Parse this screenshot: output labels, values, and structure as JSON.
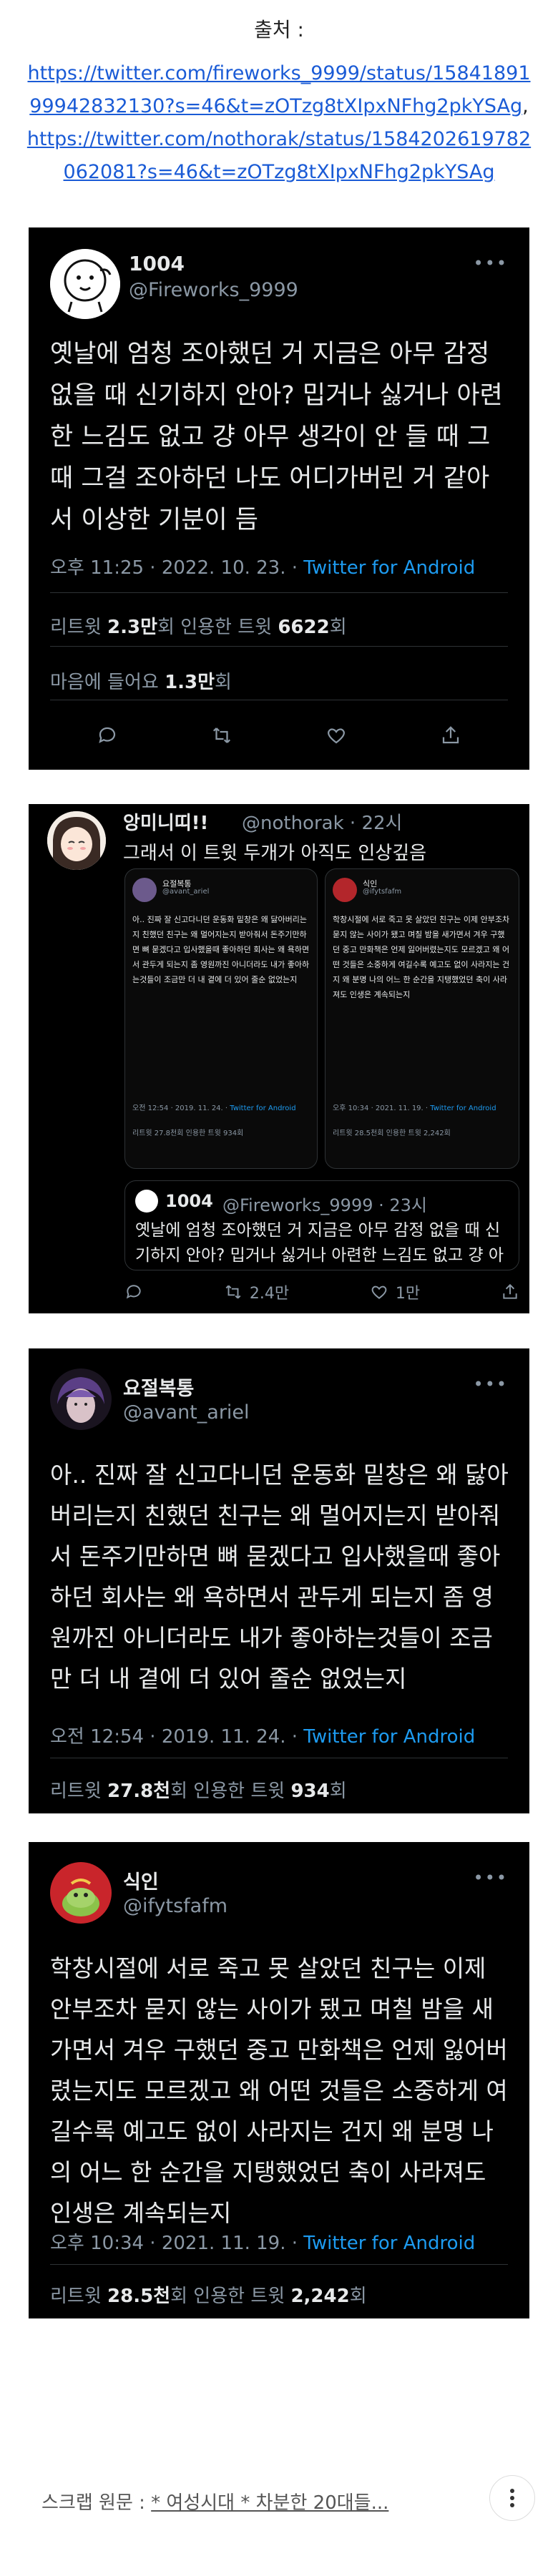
{
  "source": {
    "label": "출처 :",
    "link1": "https://twitter.com/fireworks_9999/status/1584189199942832130?s=46&t=zOTzg8tXIpxNFhg2pkYSAg",
    "link2": "https://twitter.com/nothorak/status/1584202619782062081?s=46&t=zOTzg8tXIpxNFhg2pkYSAg"
  },
  "tweet1": {
    "name": "1004",
    "handle": "@Fireworks_9999",
    "more": "•••",
    "body": "옛날에 엄청 조아했던 거 지금은 아무 감정 없을 때 신기하지 안아? 밉거나 싫거나 아련한 느김도 없고 걍 아무 생각이 안 들 때 그 때 그걸 조아하던 나도 어디가버린 거 같아서 이상한 기분이 듬",
    "time": "오후 11:25 · 2022. 10. 23. · ",
    "client": "Twitter for Android",
    "retweets_label": "리트윗 ",
    "retweets": "2.3만",
    "retweets_unit": "회  인용한 트윗 ",
    "quotes": "6622",
    "quotes_unit": "회",
    "likes_label": "마음에 들어요 ",
    "likes": "1.3만",
    "likes_unit": "회"
  },
  "tweet2": {
    "name": "앙미니띠!!",
    "handle": "@nothorak · 22시",
    "body": "그래서 이 트윗 두개가 아직도 인상깊음",
    "shotA": {
      "name": "요절복통",
      "handle": "@avant_ariel",
      "body": "아.. 진짜 잘 신고다니던 운동화 밑창은 왜 닳아버리는지 친했던 친구는 왜 멀어지는지 받아줘서 돈주기만하면 뼈 묻겠다고 입사했을때 좋아하던 회사는 왜 욕하면서 관두게 되는지 좀 영원까진 아니더라도 내가 좋아하는것들이 조금만 더 내 곁에 더 있어 줄순 없었는지",
      "time": "오전 12:54 · 2019. 11. 24. · ",
      "client": "Twitter for Android",
      "stat": "리트윗 27.8천회  인용한 트윗 934회"
    },
    "shotB": {
      "name": "식인",
      "handle": "@ifytsfafm",
      "body": "학창시절에 서로 죽고 못 살았던 친구는 이제 안부조차 묻지 않는 사이가 됐고 며칠 밤을 새가면서 겨우 구했던 중고 만화책은 언제 잃어버렸는지도 모르겠고 왜 어떤 것들은 소중하게 여길수록 예고도 없이 사라지는 건지 왜 분명 나의 어느 한 순간을 지탱했었던 축이 사라져도 인생은 계속되는지",
      "time": "오후 10:34 · 2021. 11. 19. · ",
      "client": "Twitter for Android",
      "stat": "리트윗 28.5천회  인용한 트윗 2,242회"
    },
    "quote": {
      "name": "1004",
      "handle": "@Fireworks_9999 · 23시",
      "body": "옛날에 엄청 조아했던 거 지금은 아무 감정 없을 때 신기하지 안아? 밉거나 싫거나 아련한 느김도 없고 걍 아무 생각이 안 들 때 그 때 그걸 조아하던 나도 어디가버린 거 같아..."
    },
    "retweets": "2.4만",
    "likes": "1만"
  },
  "tweet3": {
    "name": "요절복통",
    "handle": "@avant_ariel",
    "more": "•••",
    "body": "아.. 진짜 잘 신고다니던 운동화 밑창은 왜 닳아버리는지 친했던 친구는 왜 멀어지는지 받아줘서 돈주기만하면 뼈 묻겠다고 입사했을때 좋아하던 회사는 왜 욕하면서 관두게 되는지 좀 영원까진 아니더라도 내가 좋아하는것들이 조금만 더 내 곁에 더 있어 줄순 없었는지",
    "time": "오전 12:54 · 2019. 11. 24. · ",
    "client": "Twitter for Android",
    "retweets_label": "리트윗 ",
    "retweets": "27.8천",
    "retweets_unit": "회  인용한 트윗 ",
    "quotes": "934",
    "quotes_unit": "회"
  },
  "tweet4": {
    "name": "식인",
    "handle": "@ifytsfafm",
    "more": "•••",
    "body": "학창시절에 서로 죽고 못 살았던 친구는 이제 안부조차 묻지 않는 사이가 됐고 며칠 밤을 새가면서 겨우 구했던 중고 만화책은 언제 잃어버렸는지도 모르겠고 왜 어떤 것들은 소중하게 여길수록 예고도 없이 사라지는 건지 왜 분명 나의 어느 한 순간을 지탱했었던 축이 사라져도 인생은 계속되는지",
    "time": "오후 10:34 · 2021. 11. 19. · ",
    "client": "Twitter for Android",
    "retweets_label": "리트윗 ",
    "retweets": "28.5천",
    "retweets_unit": "회  인용한 트윗 ",
    "quotes": "2,242",
    "quotes_unit": "회"
  },
  "footer": {
    "label": "스크랩 원문 : ",
    "link": "* 여성시대 * 차분한 20대들..."
  },
  "icons": {
    "reply": "reply-icon",
    "retweet": "retweet-icon",
    "like": "heart-icon",
    "share": "share-icon",
    "menu": "kebab-menu-icon"
  },
  "colors": {
    "card_bg": "#000000",
    "link": "#1a5bd6",
    "twitter_blue": "#1d9bf0",
    "muted": "#8b98a5"
  }
}
